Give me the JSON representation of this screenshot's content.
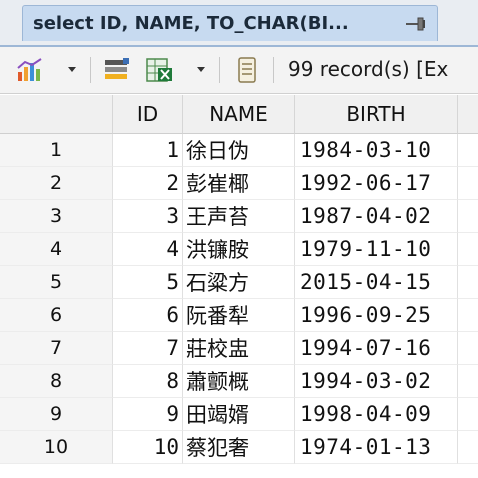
{
  "tab": {
    "title": "select ID, NAME, TO_CHAR(BI..."
  },
  "toolbar": {
    "record_status": "99 record(s) [Ex"
  },
  "grid": {
    "columns": [
      "ID",
      "NAME",
      "BIRTH"
    ],
    "rows": [
      {
        "num": "1",
        "id": "1",
        "name": "徐日伪",
        "birth": "1984-03-10"
      },
      {
        "num": "2",
        "id": "2",
        "name": "彭崔椰",
        "birth": "1992-06-17"
      },
      {
        "num": "3",
        "id": "3",
        "name": "王声苔",
        "birth": "1987-04-02"
      },
      {
        "num": "4",
        "id": "4",
        "name": "洪镰胺",
        "birth": "1979-11-10"
      },
      {
        "num": "5",
        "id": "5",
        "name": "石粱方",
        "birth": "2015-04-15"
      },
      {
        "num": "6",
        "id": "6",
        "name": "阮番犁",
        "birth": "1996-09-25"
      },
      {
        "num": "7",
        "id": "7",
        "name": "莊校盅",
        "birth": "1994-07-16"
      },
      {
        "num": "8",
        "id": "8",
        "name": "蕭颤概",
        "birth": "1994-03-02"
      },
      {
        "num": "9",
        "id": "9",
        "name": "田竭婿",
        "birth": "1998-04-09"
      },
      {
        "num": "10",
        "id": "10",
        "name": "蔡犯奢",
        "birth": "1974-01-13"
      }
    ]
  }
}
